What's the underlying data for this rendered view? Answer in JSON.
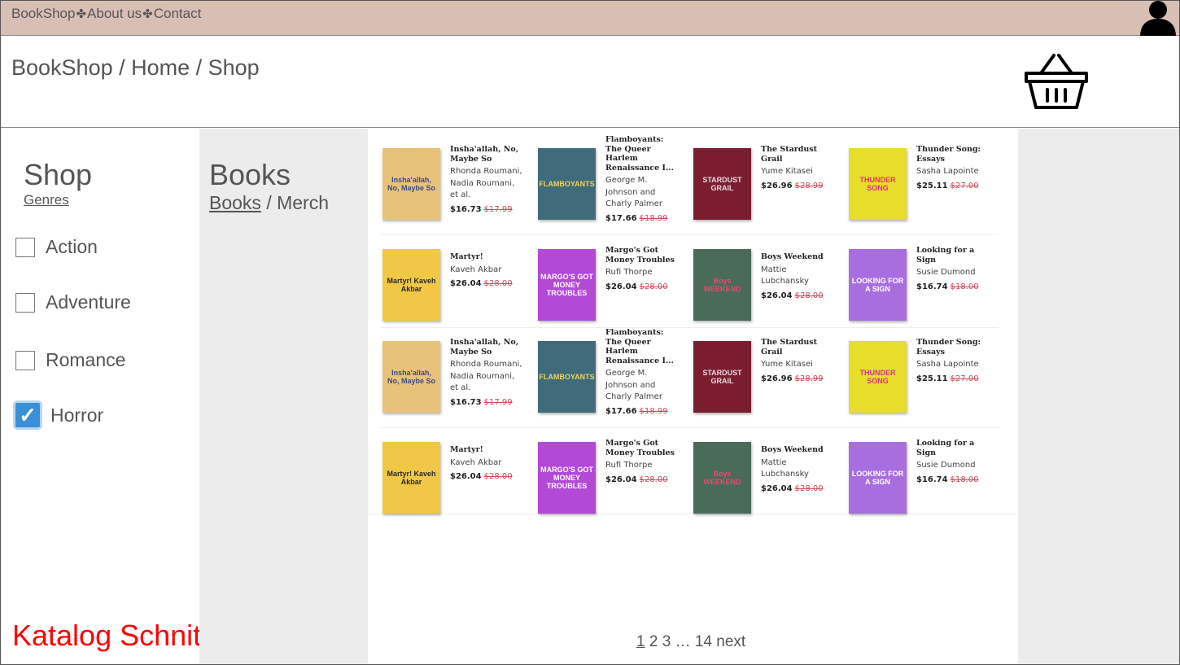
{
  "nav": {
    "items": [
      "BookShop",
      "About us",
      "Contact"
    ],
    "separator": "✤"
  },
  "header": {
    "breadcrumb": "BookShop / Home / Shop"
  },
  "sidebar": {
    "title": "Shop",
    "genres_link": "Genres",
    "genres": [
      {
        "label": "Action",
        "checked": false
      },
      {
        "label": "Adventure",
        "checked": false
      },
      {
        "label": "Romance",
        "checked": false
      },
      {
        "label": "Horror",
        "checked": true
      }
    ]
  },
  "category": {
    "title": "Books",
    "active": "Books",
    "sep": " / ",
    "other": "Merch"
  },
  "products": [
    {
      "title": "Insha'allah, No, Maybe So",
      "author": "Rhonda Roumani, Nadia Roumani, et al.",
      "price": "$16.73",
      "old": "$17.99",
      "cover": "Insha'allah, No, Maybe So",
      "cover_bg": "#e9c27a",
      "cover_fg": "#3a4c85"
    },
    {
      "title": "Flamboyants: The Queer Harlem Renaissance I...",
      "author": "George M. Johnson and Charly Palmer",
      "price": "$17.66",
      "old": "$18.99",
      "cover": "FLAMBOYANTS",
      "cover_bg": "#3f6b7a",
      "cover_fg": "#f2d15a"
    },
    {
      "title": "The Stardust Grail",
      "author": "Yume Kitasei",
      "price": "$26.96",
      "old": "$28.99",
      "cover": "STARDUST GRAIL",
      "cover_bg": "#7a1d2f",
      "cover_fg": "#e8d8e0"
    },
    {
      "title": "Thunder Song: Essays",
      "author": "Sasha Lapointe",
      "price": "$25.11",
      "old": "$27.00",
      "cover": "THUNDER SONG",
      "cover_bg": "#e6de2a",
      "cover_fg": "#e0307a"
    },
    {
      "title": "Martyr!",
      "author": "Kaveh Akbar",
      "price": "$26.04",
      "old": "$28.00",
      "cover": "Martyr! Kaveh Akbar",
      "cover_bg": "#f0c846",
      "cover_fg": "#2a2a2a"
    },
    {
      "title": "Margo's Got Money Troubles",
      "author": "Rufi Thorpe",
      "price": "$26.04",
      "old": "$28.00",
      "cover": "MARGO'S GOT MONEY TROUBLES",
      "cover_bg": "#b24ad6",
      "cover_fg": "#ffffff"
    },
    {
      "title": "Boys Weekend",
      "author": "Mattie Lubchansky",
      "price": "$26.04",
      "old": "$28.00",
      "cover": "Boys WEEKEND",
      "cover_bg": "#4a6a5a",
      "cover_fg": "#e84a6a"
    },
    {
      "title": "Looking for a Sign",
      "author": "Susie Dumond",
      "price": "$16.74",
      "old": "$18.00",
      "cover": "LOOKING FOR A SIGN",
      "cover_bg": "#a86ee0",
      "cover_fg": "#ffffff"
    },
    {
      "title": "Insha'allah, No, Maybe So",
      "author": "Rhonda Roumani, Nadia Roumani, et al.",
      "price": "$16.73",
      "old": "$17.99",
      "cover": "Insha'allah, No, Maybe So",
      "cover_bg": "#e9c27a",
      "cover_fg": "#3a4c85"
    },
    {
      "title": "Flamboyants: The Queer Harlem Renaissance I...",
      "author": "George M. Johnson and Charly Palmer",
      "price": "$17.66",
      "old": "$18.99",
      "cover": "FLAMBOYANTS",
      "cover_bg": "#3f6b7a",
      "cover_fg": "#f2d15a"
    },
    {
      "title": "The Stardust Grail",
      "author": "Yume Kitasei",
      "price": "$26.96",
      "old": "$28.99",
      "cover": "STARDUST GRAIL",
      "cover_bg": "#7a1d2f",
      "cover_fg": "#e8d8e0"
    },
    {
      "title": "Thunder Song: Essays",
      "author": "Sasha Lapointe",
      "price": "$25.11",
      "old": "$27.00",
      "cover": "THUNDER SONG",
      "cover_bg": "#e6de2a",
      "cover_fg": "#e0307a"
    },
    {
      "title": "Martyr!",
      "author": "Kaveh Akbar",
      "price": "$26.04",
      "old": "$28.00",
      "cover": "Martyr! Kaveh Akbar",
      "cover_bg": "#f0c846",
      "cover_fg": "#2a2a2a"
    },
    {
      "title": "Margo's Got Money Troubles",
      "author": "Rufi Thorpe",
      "price": "$26.04",
      "old": "$28.00",
      "cover": "MARGO'S GOT MONEY TROUBLES",
      "cover_bg": "#b24ad6",
      "cover_fg": "#ffffff"
    },
    {
      "title": "Boys Weekend",
      "author": "Mattie Lubchansky",
      "price": "$26.04",
      "old": "$28.00",
      "cover": "Boys WEEKEND",
      "cover_bg": "#4a6a5a",
      "cover_fg": "#e84a6a"
    },
    {
      "title": "Looking for a Sign",
      "author": "Susie Dumond",
      "price": "$16.74",
      "old": "$18.00",
      "cover": "LOOKING FOR A SIGN",
      "cover_bg": "#a86ee0",
      "cover_fg": "#ffffff"
    }
  ],
  "pagination": {
    "pages": [
      "1",
      "2",
      "3"
    ],
    "ellipsis": "…",
    "last": "14",
    "next": "next",
    "current": "1"
  },
  "footer": {
    "label": "Katalog Schnittstelle"
  },
  "colors": {
    "topbar": "#d8bfb4",
    "footer_label": "#ff0000",
    "old_price": "#d04a5e"
  }
}
